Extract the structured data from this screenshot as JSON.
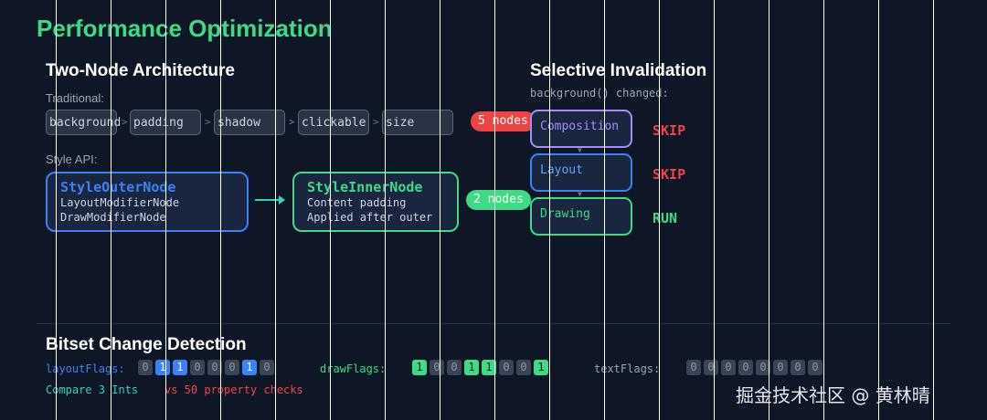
{
  "title": "Performance Optimization",
  "left": {
    "heading": "Two-Node Architecture",
    "traditional_label": "Traditional:",
    "chips": [
      "background",
      "padding",
      "shadow",
      "clickable",
      "size"
    ],
    "arrow": ">",
    "style_label": "Style API:",
    "outer": {
      "title": "StyleOuterNode",
      "lines": [
        "LayoutModifierNode",
        "DrawModifierNode"
      ]
    },
    "inner": {
      "title": "StyleInnerNode",
      "lines": [
        "Content padding",
        "Applied after outer"
      ]
    }
  },
  "right": {
    "heading": "Selective Invalidation",
    "subtitle": "background() changed:",
    "badge_red": "5 nodes",
    "badge_green": "2 nodes",
    "stages": [
      {
        "name": "Composition",
        "status": "SKIP"
      },
      {
        "name": "Layout",
        "status": "SKIP"
      },
      {
        "name": "Drawing",
        "status": "RUN"
      }
    ]
  },
  "bitset": {
    "heading": "Bitset Change Detection",
    "layout_label": "layoutFlags:",
    "layout_bits": [
      "0",
      "1",
      "1",
      "0",
      "0",
      "0",
      "1",
      "0"
    ],
    "draw_label": "drawFlags:",
    "draw_bits": [
      "1",
      "0",
      "0",
      "1",
      "1",
      "0",
      "0",
      "1"
    ],
    "text_label": "textFlags:",
    "text_bits": [
      "0",
      "0",
      "0",
      "0",
      "0",
      "0",
      "0",
      "0"
    ],
    "compare": "Compare 3 Ints",
    "vs": "vs 50 property checks"
  },
  "watermark": "掘金技术社区 @ 黄林晴",
  "colors": {
    "green": "#3ddc84",
    "blue": "#3b82f6",
    "red": "#ef4444",
    "purple": "#a78bfa"
  }
}
